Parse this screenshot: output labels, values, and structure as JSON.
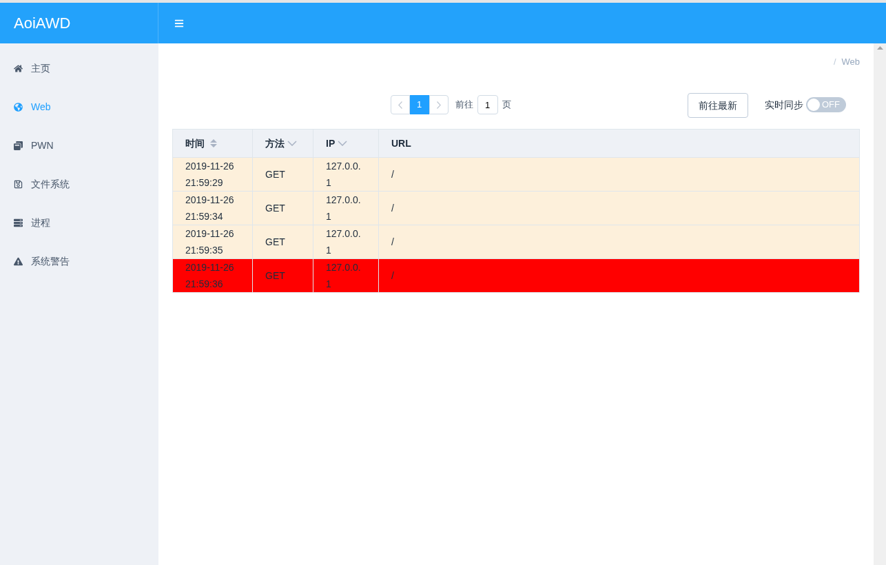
{
  "app": {
    "title": "AoiAWD"
  },
  "sidebar": {
    "items": [
      {
        "label": "主页",
        "kind": "home",
        "selected": false
      },
      {
        "label": "Web",
        "kind": "globe",
        "selected": true
      },
      {
        "label": "PWN",
        "kind": "windows",
        "selected": false
      },
      {
        "label": "文件系统",
        "kind": "save",
        "selected": false
      },
      {
        "label": "进程",
        "kind": "server",
        "selected": false
      },
      {
        "label": "系统警告",
        "kind": "warning",
        "selected": false
      }
    ]
  },
  "breadcrumb": {
    "separator": "/",
    "current": "Web"
  },
  "pagination": {
    "pages": [
      {
        "label": "1",
        "selected": true
      }
    ],
    "goto_label": "前往",
    "goto_value": "1",
    "page_suffix": "页"
  },
  "latest_button": "前往最新",
  "sync": {
    "label": "实时同步",
    "on": false,
    "state_text": "OFF"
  },
  "table": {
    "columns": [
      {
        "label": "时间",
        "kind": "sortable"
      },
      {
        "label": "方法",
        "kind": "filter"
      },
      {
        "label": "IP",
        "kind": "filter"
      },
      {
        "label": "URL",
        "kind": "plain"
      }
    ],
    "rows": [
      {
        "time": "2019-11-26 21:59:29",
        "method": "GET",
        "ip": "127.0.0.1",
        "url": "/",
        "color": "#fdf0db"
      },
      {
        "time": "2019-11-26 21:59:34",
        "method": "GET",
        "ip": "127.0.0.1",
        "url": "/",
        "color": "#fdf0db"
      },
      {
        "time": "2019-11-26 21:59:35",
        "method": "GET",
        "ip": "127.0.0.1",
        "url": "/",
        "color": "#fdf0db"
      },
      {
        "time": "2019-11-26 21:59:36",
        "method": "GET",
        "ip": "127.0.0.1",
        "url": "/",
        "color": "#ff0000"
      }
    ]
  }
}
